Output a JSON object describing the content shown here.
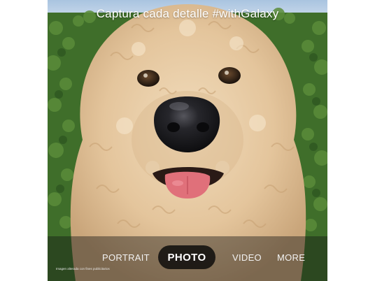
{
  "headline": "Captura cada detalle  #withGalaxy",
  "camera_modes": {
    "portrait": "PORTRAIT",
    "photo": "PHOTO",
    "video": "VIDEO",
    "more": "MORE",
    "selected": "PHOTO"
  },
  "disclaimer": "Imagen alterada con fines publicitarios",
  "colors": {
    "sky": "#b9d0e6",
    "hedge": "#3f6e2a",
    "fur": "#e6c9a2",
    "nose": "#1e1e22",
    "tongue": "#e0707a"
  }
}
